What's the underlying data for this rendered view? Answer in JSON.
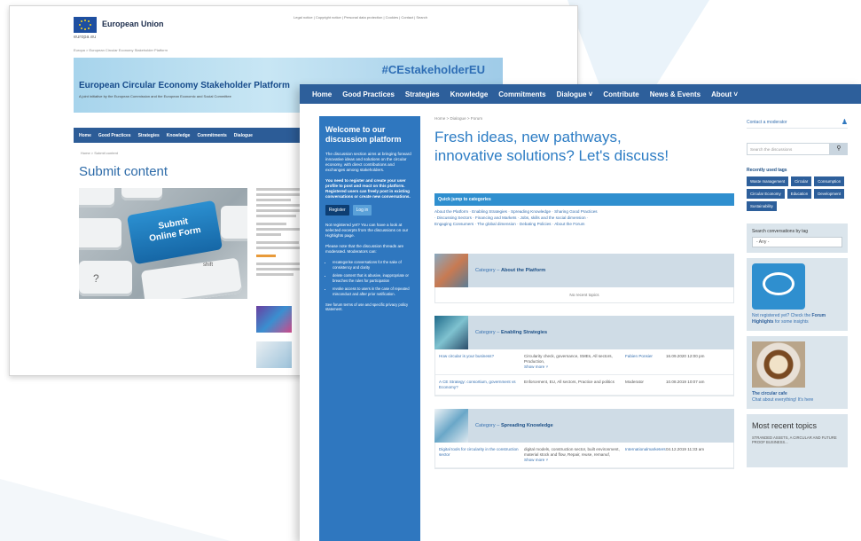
{
  "back_page": {
    "org_name": "European Union",
    "flag_caption": "europa.eu",
    "top_links": "Legal notice | Copyright notice | Personal data protection | Cookies | Contact | Search",
    "breadcrumb_top": "Europa > European Circular Economy Stakeholder Platform",
    "banner": {
      "hashtag": "#CEstakeholderEU",
      "title": "European Circular Economy Stakeholder Platform",
      "subtitle": "A joint initiative by the European Commission and the European Economic and Social Committee"
    },
    "nav": [
      "Home",
      "Good Practices",
      "Strategies",
      "Knowledge",
      "Commitments",
      "Dialogue"
    ],
    "breadcrumb": "Home > Submit content",
    "page_title": "Submit content",
    "key_text": "Submit\nOnline Form",
    "shift_label": "shift",
    "q_label": "?"
  },
  "front_page": {
    "nav": [
      "Home",
      "Good Practices",
      "Strategies",
      "Knowledge",
      "Commitments",
      "Dialogue ˅",
      "Contribute",
      "News & Events",
      "About ˅"
    ],
    "welcome": {
      "title": "Welcome to our discussion platform",
      "p1": "The discussion section aims at bringing forward innovative ideas and solutions on the circular economy, with direct contributions and exchanges among stakeholders.",
      "p2": "You need to register and create your user profile to post and react on this platform. Registered users can freely post in existing conversations or create new conversations.",
      "register": "Register",
      "login": "Log in",
      "p3": "Not registered yet? You can have a look at selected excerpts from the discussions on our Highlights page.",
      "p4": "Please note that the discussion threads are moderated. Moderators can:",
      "bullets": [
        "recategorise conversations for the sake of consistency and clarity",
        "delete content that is abusive, inappropriate or breaches the rules for participation",
        "revoke access to users in the case of repeated misconduct and after prior notification."
      ],
      "footer": "See forum terms of use and specific privacy policy statement."
    },
    "main": {
      "breadcrumb": "Home > Dialogue > Forum",
      "headline_line1": "Fresh ideas, new pathways,",
      "headline_line2": "innovative solutions? Let's discuss!",
      "quick_jump": "Quick jump to categories",
      "quick_links_1": "About the Platform · Enabling Strategies · Spreading Knowledge · Sharing Good Practices",
      "quick_links_2": "· Discussing Sectors · Financing and Markets · Jobs, skills and the social dimension ·",
      "quick_links_3": "Engaging Consumers · The global dimension · Debating Policies · About the Forum",
      "categories": [
        {
          "prefix": "Category –",
          "name": "About the Platform",
          "empty_text": "No recent topics",
          "topics": []
        },
        {
          "prefix": "Category –",
          "name": "Enabling Strategies",
          "empty_text": "",
          "topics": [
            {
              "title": "How circular is your business?",
              "tags": "Circularity check, governance, SMEs, All sectors, Production,",
              "more": "Show more ˅",
              "author": "Fabien Ponsier",
              "date": "16.09.2020 12:00 pm"
            },
            {
              "title": "A CE Strategy: consortium, government vs Economy?",
              "tags": "Enforcement, EU, All sectors, Practice and politics",
              "more": "",
              "author": "Moderator",
              "date": "10.08.2019 10:07 am"
            }
          ]
        },
        {
          "prefix": "Category –",
          "name": "Spreading Knowledge",
          "empty_text": "",
          "topics": [
            {
              "title": "Digital tools for circularity in the construction sector",
              "tags": "digital models, construction sector, built environment, material stock and flow, Repair, reuse, remanuf,",
              "more": "Show more ˅",
              "author": "Internationalmarketers",
              "date": "04.12.2019 11:33 am"
            }
          ]
        }
      ]
    },
    "sidebar": {
      "contact": "Contact a moderator",
      "search_placeholder": "Search the discussions",
      "recent_tags_title": "Recently used tags",
      "tags": [
        "Waste management",
        "Circular",
        "Consumption",
        "Circular Economy",
        "Education",
        "Development",
        "Sustainability"
      ],
      "search_by_tag": "Search conversations by tag",
      "search_tag_value": "- Any -",
      "highlights_text_1": "Not registered yet? Check the",
      "highlights_link": "Forum Highlights",
      "highlights_text_2": "for some insights",
      "cafe_title": "The circular cafe",
      "cafe_text": "Chat about everything! It's here",
      "recent_title": "Most recent topics",
      "recent_item": "STRANDED ASSETS, A CIRCULAR AND FUTURE PROOF BUSINESS..."
    }
  },
  "colors": {
    "nav_blue": "#2d5f9b",
    "welcome_blue": "#2f77bf",
    "headline_blue": "#2c7cc4",
    "category_bg": "#cfdce6"
  }
}
